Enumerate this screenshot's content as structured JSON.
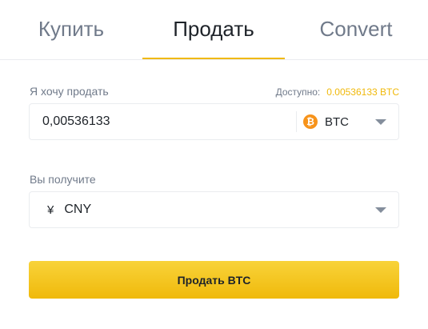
{
  "tabs": [
    {
      "label": "Купить",
      "active": false
    },
    {
      "label": "Продать",
      "active": true
    },
    {
      "label": "Convert",
      "active": false
    }
  ],
  "accent_color": "#f0b90b",
  "sell_field": {
    "label": "Я хочу продать",
    "available_label": "Доступно:",
    "available_value": "0.00536133 BTC",
    "amount": "0,00536133",
    "coin": "BTC",
    "coin_icon": "bitcoin-icon",
    "coin_icon_glyph": "₿"
  },
  "receive_field": {
    "label": "Вы получите",
    "currency_symbol": "¥",
    "currency": "CNY"
  },
  "submit": {
    "label": "Продать BTC"
  }
}
